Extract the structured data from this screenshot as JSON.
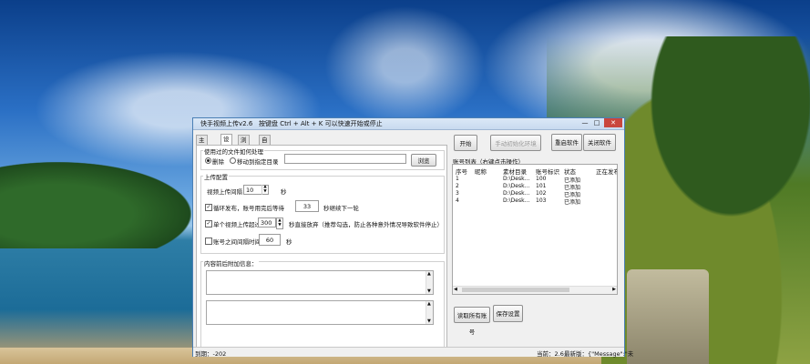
{
  "window": {
    "title": "快手视频上传v2.6",
    "hint": "按键盘 Ctrl + Alt + K 可以快速开始或停止",
    "min": "—",
    "max": "□",
    "close": "✕"
  },
  "tabs": [
    "主界面",
    "设置",
    "浏览器",
    "自动操作"
  ],
  "settings": {
    "used_files_label": "使用过的文件如何处理",
    "opt_delete": "删除",
    "opt_move": "移动到指定目录",
    "browse": "浏览",
    "upload_config_label": "上传配置",
    "video_interval_label": "视频上传间隔",
    "video_interval_value": "10",
    "seconds": "秒",
    "loop_label": "循环发布，账号用完后等待",
    "loop_value": "33",
    "loop_suffix": "秒继续下一轮",
    "single_label": "单个视频上传超过",
    "single_value": "300",
    "single_suffix": "秒直接放弃（推荐勾选，防止各种意外情况导致软件停止）",
    "account_interval_label": "账号之间间隔时间",
    "account_interval_value": "60",
    "content_label": "内容前后附加信息："
  },
  "right": {
    "start": "开始",
    "init_env": "手动初始化环境",
    "restart": "重启软件",
    "close_app": "关闭软件",
    "list_title": "账号列表（右键点击操作）",
    "columns": [
      "序号",
      "昵称",
      "素材目录",
      "账号标识",
      "状态",
      "正在发布"
    ],
    "rows": [
      [
        "1",
        "",
        "D:\\Desk…",
        "100",
        "已添加"
      ],
      [
        "2",
        "",
        "D:\\Desk…",
        "101",
        "已添加"
      ],
      [
        "3",
        "",
        "D:\\Desk…",
        "102",
        "已添加"
      ],
      [
        "4",
        "",
        "D:\\Desk…",
        "103",
        "已添加"
      ]
    ],
    "read_accounts": "读取所有账号",
    "save_settings": "保存设置"
  },
  "status": {
    "left": "到期：-202",
    "count": "当前：2.6",
    "latest": "最新版：{\"Message\":\"未"
  }
}
